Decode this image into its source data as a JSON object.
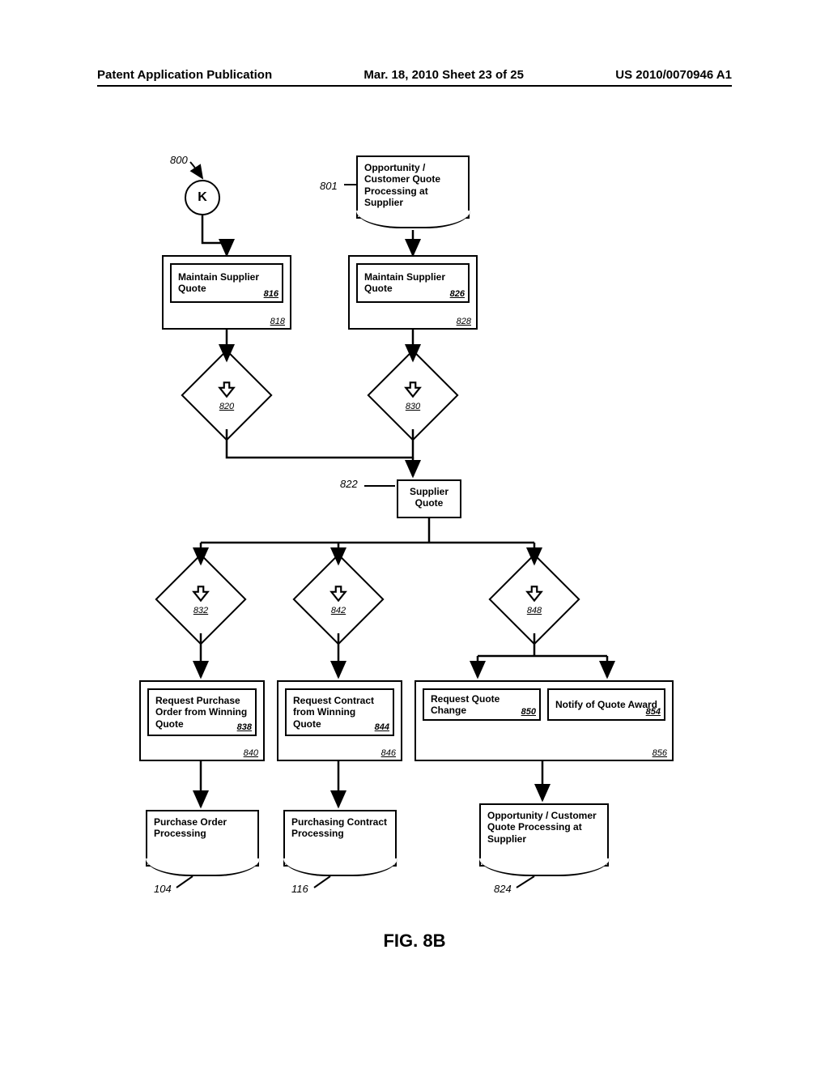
{
  "header": {
    "left": "Patent Application Publication",
    "center": "Mar. 18, 2010  Sheet 23 of 25",
    "right": "US 2010/0070946 A1"
  },
  "figure_label": "FIG. 8B",
  "refs": {
    "r800": "800",
    "r801": "801",
    "r816": "816",
    "r818": "818",
    "r820": "820",
    "r822": "822",
    "r824": "824",
    "r826": "826",
    "r828": "828",
    "r830": "830",
    "r832": "832",
    "r838": "838",
    "r840": "840",
    "r842": "842",
    "r844": "844",
    "r846": "846",
    "r848": "848",
    "r850": "850",
    "r854": "854",
    "r856": "856",
    "r104": "104",
    "r116": "116"
  },
  "nodes": {
    "connector_k": "K",
    "doc_801": "Opportunity / Customer Quote Processing at Supplier",
    "proc_816": "Maintain Supplier Quote",
    "proc_826": "Maintain Supplier Quote",
    "box_822": "Supplier Quote",
    "proc_838": "Request Purchase Order from Winning Quote",
    "proc_844": "Request Contract from Winning Quote",
    "proc_850": "Request Quote Change",
    "proc_854": "Notify of Quote Award",
    "doc_104": "Purchase Order Processing",
    "doc_116": "Purchasing Contract Processing",
    "doc_824": "Opportunity / Customer Quote Processing at Supplier"
  }
}
